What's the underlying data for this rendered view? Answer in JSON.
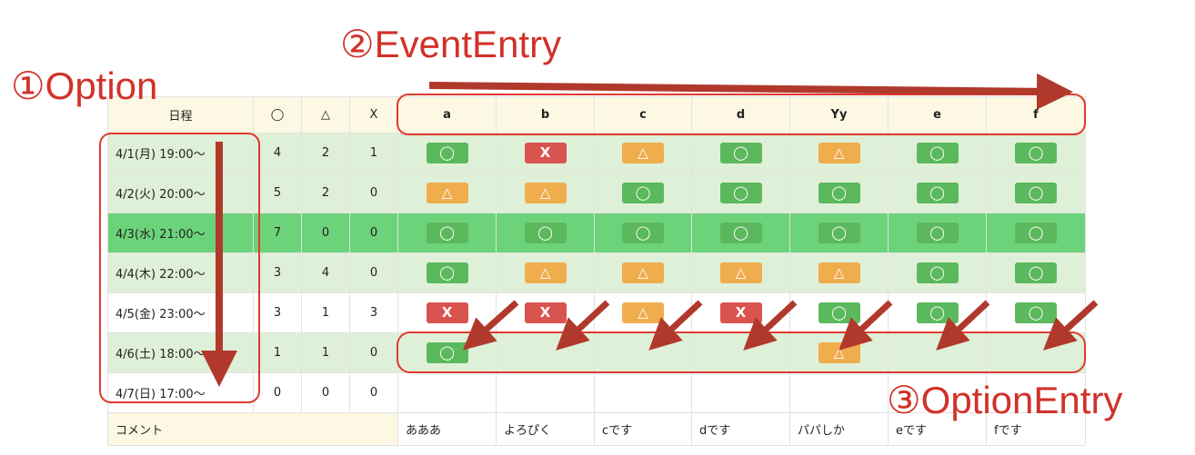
{
  "annotations": {
    "option": "①Option",
    "event_entry": "②EventEntry",
    "option_entry": "③OptionEntry"
  },
  "table": {
    "header": {
      "schedule": "日程",
      "ok": "◯",
      "maybe": "△",
      "no": "X",
      "events": [
        "a",
        "b",
        "c",
        "d",
        "Yy",
        "e",
        "f"
      ]
    },
    "rows": [
      {
        "option": "4/1(月) 19:00〜",
        "counts": [
          "4",
          "2",
          "1"
        ],
        "style": "light",
        "entries": [
          "ok",
          "no",
          "maybe",
          "ok",
          "maybe",
          "ok",
          "ok"
        ]
      },
      {
        "option": "4/2(火) 20:00〜",
        "counts": [
          "5",
          "2",
          "0"
        ],
        "style": "light",
        "entries": [
          "maybe",
          "maybe",
          "ok",
          "ok",
          "ok",
          "ok",
          "ok"
        ]
      },
      {
        "option": "4/3(水) 21:00〜",
        "counts": [
          "7",
          "0",
          "0"
        ],
        "style": "best",
        "entries": [
          "ok",
          "ok",
          "ok",
          "ok",
          "ok",
          "ok",
          "ok"
        ]
      },
      {
        "option": "4/4(木) 22:00〜",
        "counts": [
          "3",
          "4",
          "0"
        ],
        "style": "light",
        "entries": [
          "ok",
          "maybe",
          "maybe",
          "maybe",
          "maybe",
          "ok",
          "ok"
        ]
      },
      {
        "option": "4/5(金) 23:00〜",
        "counts": [
          "3",
          "1",
          "3"
        ],
        "style": "white",
        "entries": [
          "no",
          "no",
          "maybe",
          "no",
          "ok",
          "ok",
          "ok"
        ]
      },
      {
        "option": "4/6(土) 18:00〜",
        "counts": [
          "1",
          "1",
          "0"
        ],
        "style": "light",
        "entries": [
          "ok",
          "",
          "",
          "",
          "maybe",
          "",
          ""
        ]
      },
      {
        "option": "4/7(日) 17:00〜",
        "counts": [
          "0",
          "0",
          "0"
        ],
        "style": "white",
        "entries": [
          "",
          "",
          "",
          "",
          "",
          "",
          ""
        ]
      }
    ],
    "comment_label": "コメント",
    "comments": [
      "あああ",
      "よろぴく",
      "cです",
      "dです",
      "パパしか",
      "eです",
      "fです"
    ]
  },
  "symbols": {
    "ok": "◯",
    "maybe": "△",
    "no": "X"
  },
  "colors": {
    "accent_red": "#d0322a",
    "ok_green": "#5cb85c",
    "maybe_orange": "#f0ad4e",
    "no_red": "#d9534f",
    "row_green": "#dff0d8",
    "best_row_green": "#6dd37a",
    "header_beige": "#fcf8e3"
  }
}
